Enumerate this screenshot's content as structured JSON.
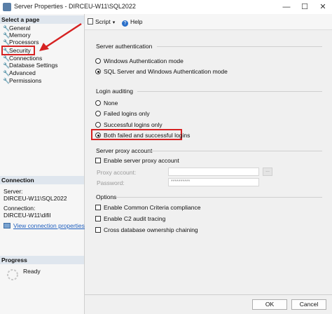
{
  "window": {
    "title": "Server Properties - DIRCEU-W11\\SQL2022",
    "minimize": "—",
    "maximize": "☐",
    "close": "✕"
  },
  "left": {
    "select_page_header": "Select a page",
    "pages": [
      "General",
      "Memory",
      "Processors",
      "Security",
      "Connections",
      "Database Settings",
      "Advanced",
      "Permissions"
    ],
    "connection_header": "Connection",
    "server_label": "Server:",
    "server_value": "DIRCEU-W11\\SQL2022",
    "connection_label": "Connection:",
    "connection_value": "DIRCEU-W11\\difil",
    "view_connection_link": "View connection properties",
    "progress_header": "Progress",
    "progress_status": "Ready"
  },
  "toolbar": {
    "script_label": "Script",
    "help_label": "Help"
  },
  "auth": {
    "group_label": "Server authentication",
    "windows_mode": "Windows Authentication mode",
    "mixed_mode": "SQL Server and Windows Authentication mode",
    "selected": "mixed"
  },
  "auditing": {
    "group_label": "Login auditing",
    "none": "None",
    "failed": "Failed logins only",
    "successful": "Successful logins only",
    "both": "Both failed and successful logins",
    "selected": "both"
  },
  "proxy": {
    "group_label": "Server proxy account",
    "enable_label": "Enable server proxy account",
    "proxy_account_label": "Proxy account:",
    "password_label": "Password:",
    "password_value": "**********",
    "browse_label": "..."
  },
  "options": {
    "group_label": "Options",
    "common_criteria": "Enable Common Criteria compliance",
    "c2_audit": "Enable C2 audit tracing",
    "cross_db": "Cross database ownership chaining"
  },
  "footer": {
    "ok": "OK",
    "cancel": "Cancel"
  },
  "colors": {
    "highlight_red": "#d62222",
    "link_blue": "#1f5fbf",
    "header_bg": "#dfe6ee"
  }
}
